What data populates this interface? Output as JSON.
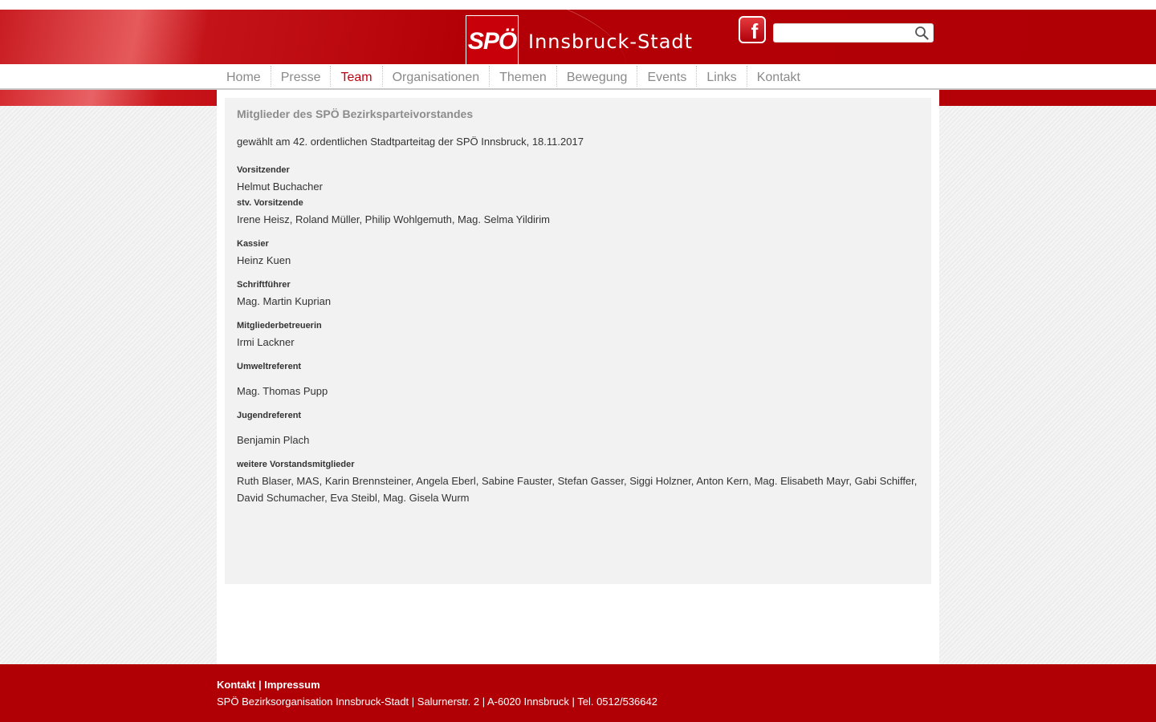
{
  "header": {
    "logo_text": "SPÖ",
    "site_title": "Innsbruck-Stadt",
    "facebook_glyph": "f",
    "search": {
      "value": "",
      "placeholder": ""
    }
  },
  "nav": {
    "items": [
      {
        "label": "Home"
      },
      {
        "label": "Presse"
      },
      {
        "label": "Team"
      },
      {
        "label": "Organisationen"
      },
      {
        "label": "Themen"
      },
      {
        "label": "Bewegung"
      },
      {
        "label": "Events"
      },
      {
        "label": "Links"
      },
      {
        "label": "Kontakt"
      }
    ],
    "active": "Team"
  },
  "content": {
    "title": "Mitglieder des SPÖ Bezirksparteivorstandes",
    "intro": "gewählt am 42. ordentlichen Stadtparteitag der SPÖ Innsbruck, 18.11.2017",
    "sections": [
      {
        "label": "Vorsitzender",
        "value": "Helmut Buchacher"
      },
      {
        "label": "stv. Vorsitzende",
        "value": "Irene Heisz, Roland Müller, Philip Wohlgemuth, Mag. Selma Yildirim"
      },
      {
        "label": "Kassier",
        "value": "Heinz Kuen"
      },
      {
        "label": "Schriftführer",
        "value": "Mag. Martin Kuprian"
      },
      {
        "label": "Mitgliederbetreuerin",
        "value": "Irmi Lackner"
      },
      {
        "label": "Umweltreferent",
        "value": "Mag. Thomas Pupp"
      },
      {
        "label": "Jugendreferent",
        "value": "Benjamin Plach"
      },
      {
        "label": "weitere Vorstandsmitglieder",
        "value": "Ruth Blaser, MAS, Karin Brennsteiner, Angela Eberl, Sabine Fauster, Stefan Gasser, Siggi Holzner, Anton Kern, Mag. Elisabeth Mayr, Gabi Schiffer, David Schumacher, Eva Steibl, Mag. Gisela Wurm"
      }
    ]
  },
  "footer": {
    "kontakt": "Kontakt",
    "separator": " | ",
    "impressum": "Impressum",
    "address": "SPÖ Bezirksorganisation Innsbruck-Stadt | Salurnerstr. 2 | A-6020 Innsbruck | Tel. 0512/536642"
  },
  "colors": {
    "brand_red": "#b00006",
    "active_nav": "#c00010",
    "nav_text": "#8a8a8a",
    "content_bg": "#f2f2f2"
  }
}
